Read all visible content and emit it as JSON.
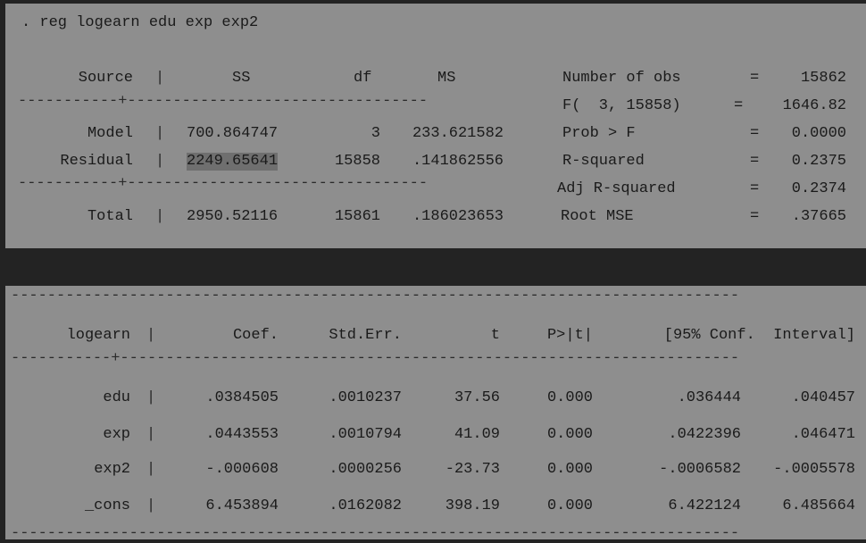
{
  "command": ". reg logearn edu exp exp2",
  "anova": {
    "headers": {
      "source": "Source",
      "ss": "SS",
      "df": "df",
      "ms": "MS"
    },
    "rows": [
      {
        "source": "Model",
        "ss": "700.864747",
        "df": "3",
        "ms": "233.621582"
      },
      {
        "source": "Residual",
        "ss": "2249.65641",
        "df": "15858",
        "ms": ".141862556"
      },
      {
        "source": "Total",
        "ss": "2950.52116",
        "df": "15861",
        "ms": ".186023653"
      }
    ]
  },
  "stats": [
    {
      "label": "Number of obs",
      "eq": "=",
      "value": "15862"
    },
    {
      "label": "F(  3, 15858)",
      "eq": "=",
      "value": "1646.82"
    },
    {
      "label": "Prob > F",
      "eq": "=",
      "value": "0.0000"
    },
    {
      "label": "R-squared",
      "eq": "=",
      "value": "0.2375"
    },
    {
      "label": "Adj R-squared",
      "eq": "=",
      "value": "0.2374"
    },
    {
      "label": "Root MSE",
      "eq": "=",
      "value": ".37665"
    }
  ],
  "coef": {
    "headers": {
      "var": "logearn",
      "coef": "Coef.",
      "se": "Std.Err.",
      "t": "t",
      "p": "P>|t|",
      "ci": "[95% Conf.  Interval]"
    },
    "rows": [
      {
        "var": "edu",
        "coef": ".0384505",
        "se": ".0010237",
        "t": "37.56",
        "p": "0.000",
        "lo": ".036444",
        "hi": ".040457"
      },
      {
        "var": "exp",
        "coef": ".0443553",
        "se": ".0010794",
        "t": "41.09",
        "p": "0.000",
        "lo": ".0422396",
        "hi": ".046471"
      },
      {
        "var": "exp2",
        "coef": "-.000608",
        "se": ".0000256",
        "t": "-23.73",
        "p": "0.000",
        "lo": "-.0006582",
        "hi": "-.0005578"
      },
      {
        "var": "_cons",
        "coef": "6.453894",
        "se": ".0162082",
        "t": "398.19",
        "p": "0.000",
        "lo": "6.422124",
        "hi": "6.485664"
      }
    ]
  }
}
